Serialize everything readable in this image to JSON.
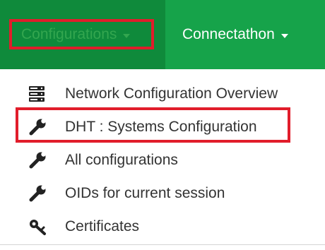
{
  "navbar": {
    "background": "#16a34a",
    "active_background": "#0f8a3b",
    "items": [
      {
        "label": "Configurations",
        "icon": "caret-down-icon",
        "active": true
      },
      {
        "label": "Connectathon",
        "icon": "caret-down-icon",
        "active": false
      }
    ]
  },
  "menu": {
    "items": [
      {
        "label": "Network Configuration Overview",
        "icon": "server-stack-icon"
      },
      {
        "label": "DHT : Systems Configuration",
        "icon": "wrench-icon"
      },
      {
        "label": "All configurations",
        "icon": "wrench-icon"
      },
      {
        "label": "OIDs for current session",
        "icon": "wrench-icon"
      },
      {
        "label": "Certificates",
        "icon": "key-icon"
      }
    ]
  },
  "highlights": {
    "color": "#e11d2b",
    "targets": [
      "Configurations",
      "DHT : Systems Configuration"
    ]
  }
}
